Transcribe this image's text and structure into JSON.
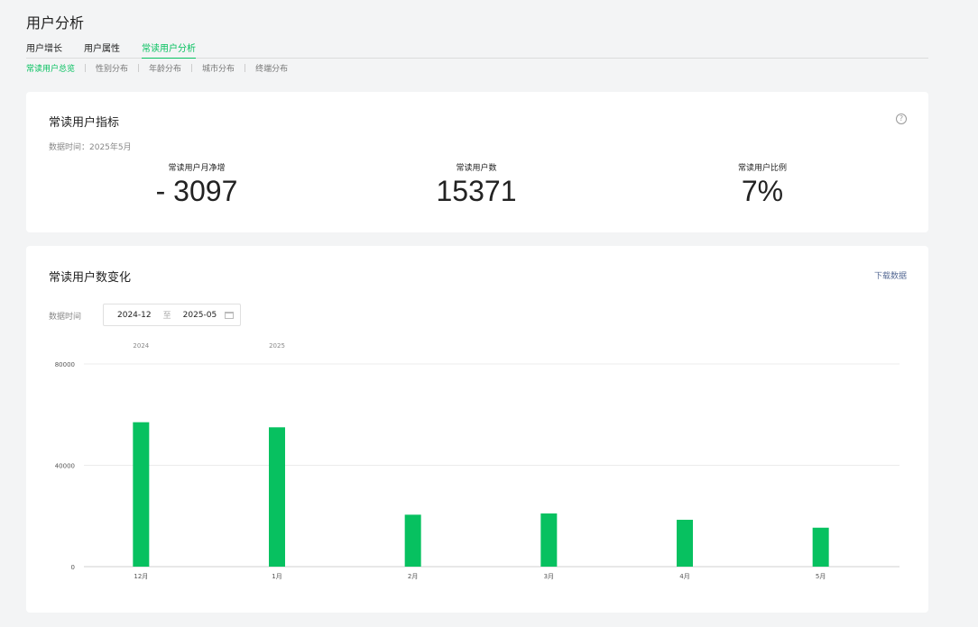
{
  "page": {
    "title": "用户分析"
  },
  "tabs": [
    {
      "label": "用户增长",
      "active": false
    },
    {
      "label": "用户属性",
      "active": false
    },
    {
      "label": "常读用户分析",
      "active": true
    }
  ],
  "subtabs": [
    {
      "label": "常读用户总览",
      "active": true
    },
    {
      "label": "性别分布",
      "active": false
    },
    {
      "label": "年龄分布",
      "active": false
    },
    {
      "label": "城市分布",
      "active": false
    },
    {
      "label": "终端分布",
      "active": false
    }
  ],
  "indicators": {
    "title": "常读用户指标",
    "help_icon": "?",
    "data_time": "数据时间：2025年5月",
    "metrics": [
      {
        "label": "常读用户月净增",
        "value": "- 3097"
      },
      {
        "label": "常读用户数",
        "value": "15371"
      },
      {
        "label": "常读用户比例",
        "value": "7%"
      }
    ]
  },
  "trend": {
    "title": "常读用户数变化",
    "download_label": "下载数据",
    "range_label": "数据时间",
    "range_start": "2024-12",
    "range_separator": "至",
    "range_end": "2025-05"
  },
  "colors": {
    "accent": "#07c160",
    "link": "#576b95"
  },
  "chart_data": {
    "type": "bar",
    "categories": [
      "12月",
      "1月",
      "2月",
      "3月",
      "4月",
      "5月"
    ],
    "year_labels": [
      {
        "label": "2024",
        "category_index": 0
      },
      {
        "label": "2025",
        "category_index": 1
      }
    ],
    "values": [
      57000,
      55000,
      20500,
      21000,
      18500,
      15371
    ],
    "y_ticks": [
      0,
      40000,
      80000
    ],
    "ylim": [
      0,
      80000
    ],
    "grid": true,
    "color": "#07c160"
  }
}
